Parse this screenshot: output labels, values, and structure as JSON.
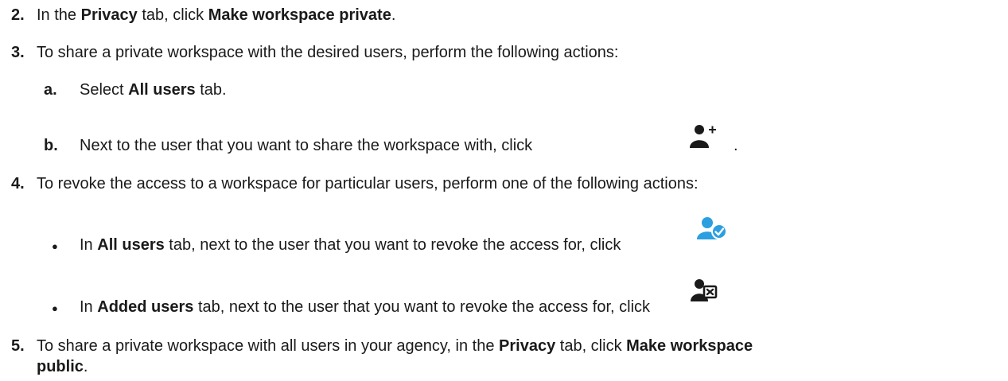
{
  "steps": {
    "s2": {
      "num": "2.",
      "t1": "In the ",
      "b1": "Privacy",
      "t2": " tab, click ",
      "b2": "Make workspace private",
      "t3": "."
    },
    "s3": {
      "num": "3.",
      "text": "To share a private workspace with the desired users, perform the following actions:",
      "a": {
        "num": "a.",
        "t1": "Select ",
        "b1": "All users",
        "t2": " tab."
      },
      "b": {
        "num": "b.",
        "text": "Next to the user that you want to share the workspace with, click",
        "after": "."
      }
    },
    "s4": {
      "num": "4.",
      "text": "To revoke the access to a workspace for particular users, perform one of the following actions:",
      "bullet1": {
        "t1": "In ",
        "b1": "All users",
        "t2": " tab, next to the user that you want to revoke the access for, click"
      },
      "bullet2": {
        "t1": "In ",
        "b1": "Added users",
        "t2": " tab, next to the user that you want to revoke the access for, click"
      }
    },
    "s5": {
      "num": "5.",
      "t1": "To share a private workspace with all users in your agency, in the ",
      "b1": "Privacy",
      "t2": " tab, click ",
      "b2": "Make workspace",
      "b3": "public",
      "t3": "."
    }
  },
  "icons": {
    "add_user": "add-user-icon",
    "user_shared": "user-shared-check-icon",
    "remove_user": "remove-user-icon",
    "colors": {
      "dark": "#1a1a1a",
      "accent": "#2b9fe0"
    }
  }
}
